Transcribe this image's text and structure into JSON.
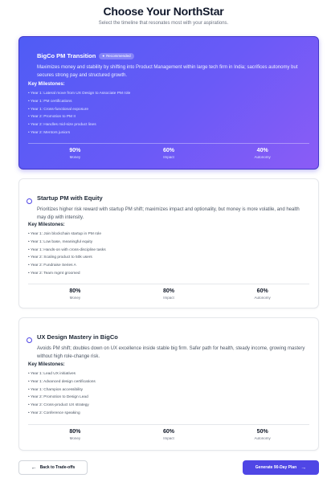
{
  "header": {
    "title": "Choose Your NorthStar",
    "subtitle": "Select the timeline that resonates most with your aspirations."
  },
  "cards": [
    {
      "title": "BigCo PM Transition",
      "badge": "Recommended",
      "description": "Maximizes money and stability by shifting into Product Management within large tech firm in India; sacrifices autonomy but secures strong pay and structured growth.",
      "milestones_label": "Key Milestones:",
      "milestones": [
        "Year 1: Lateral move from UX Design to Associate PM role",
        "Year 1: PM certifications",
        "Year 1: Cross-functional exposure",
        "Year 2: Promotion to PM II",
        "Year 2: Handles mid-size product lines",
        "Year 2: Mentors juniors"
      ],
      "metrics": [
        {
          "value": "90%",
          "label": "Money"
        },
        {
          "value": "60%",
          "label": "Impact"
        },
        {
          "value": "40%",
          "label": "Autonomy"
        }
      ]
    },
    {
      "title": "Startup PM with Equity",
      "description": "Prioritizes higher risk reward with startup PM shift; maximizes impact and optionality, but money is more volatile, and health may dip with intensity.",
      "milestones_label": "Key Milestones:",
      "milestones": [
        "Year 1: Join blockchain startup in PM role",
        "Year 1: Low base, meaningful equity",
        "Year 1: Hands-on with cross-discipline tasks",
        "Year 2: Scaling product to 50k users",
        "Year 2: Fundraise Series A",
        "Year 2: Team mgmt groomed"
      ],
      "metrics": [
        {
          "value": "80%",
          "label": "Money"
        },
        {
          "value": "80%",
          "label": "Impact"
        },
        {
          "value": "60%",
          "label": "Autonomy"
        }
      ]
    },
    {
      "title": "UX Design Mastery in BigCo",
      "description": "Avoids PM shift; doubles down on UX excellence inside stable big firm. Safer path for health, steady income, growing mastery without high role-change risk.",
      "milestones_label": "Key Milestones:",
      "milestones": [
        "Year 1: Lead UX initiatives",
        "Year 1: Advanced design certifications",
        "Year 1: Champion accessibility",
        "Year 2: Promotion to Design Lead",
        "Year 2: Cross-product UX strategy",
        "Year 2: Conference speaking"
      ],
      "metrics": [
        {
          "value": "80%",
          "label": "Money"
        },
        {
          "value": "60%",
          "label": "Impact"
        },
        {
          "value": "50%",
          "label": "Autonomy"
        }
      ]
    }
  ],
  "footer": {
    "back_label": "Back to Trade-offs",
    "next_label": "Generate 90-Day Plan"
  },
  "icons": {
    "back": "arrow-left-icon",
    "next": "arrow-right-icon",
    "badge": "star-icon"
  },
  "colors": {
    "accent": "#4f46e5",
    "selected_gradient_start": "#4f5cf5",
    "selected_gradient_end": "#8b5cf6"
  }
}
